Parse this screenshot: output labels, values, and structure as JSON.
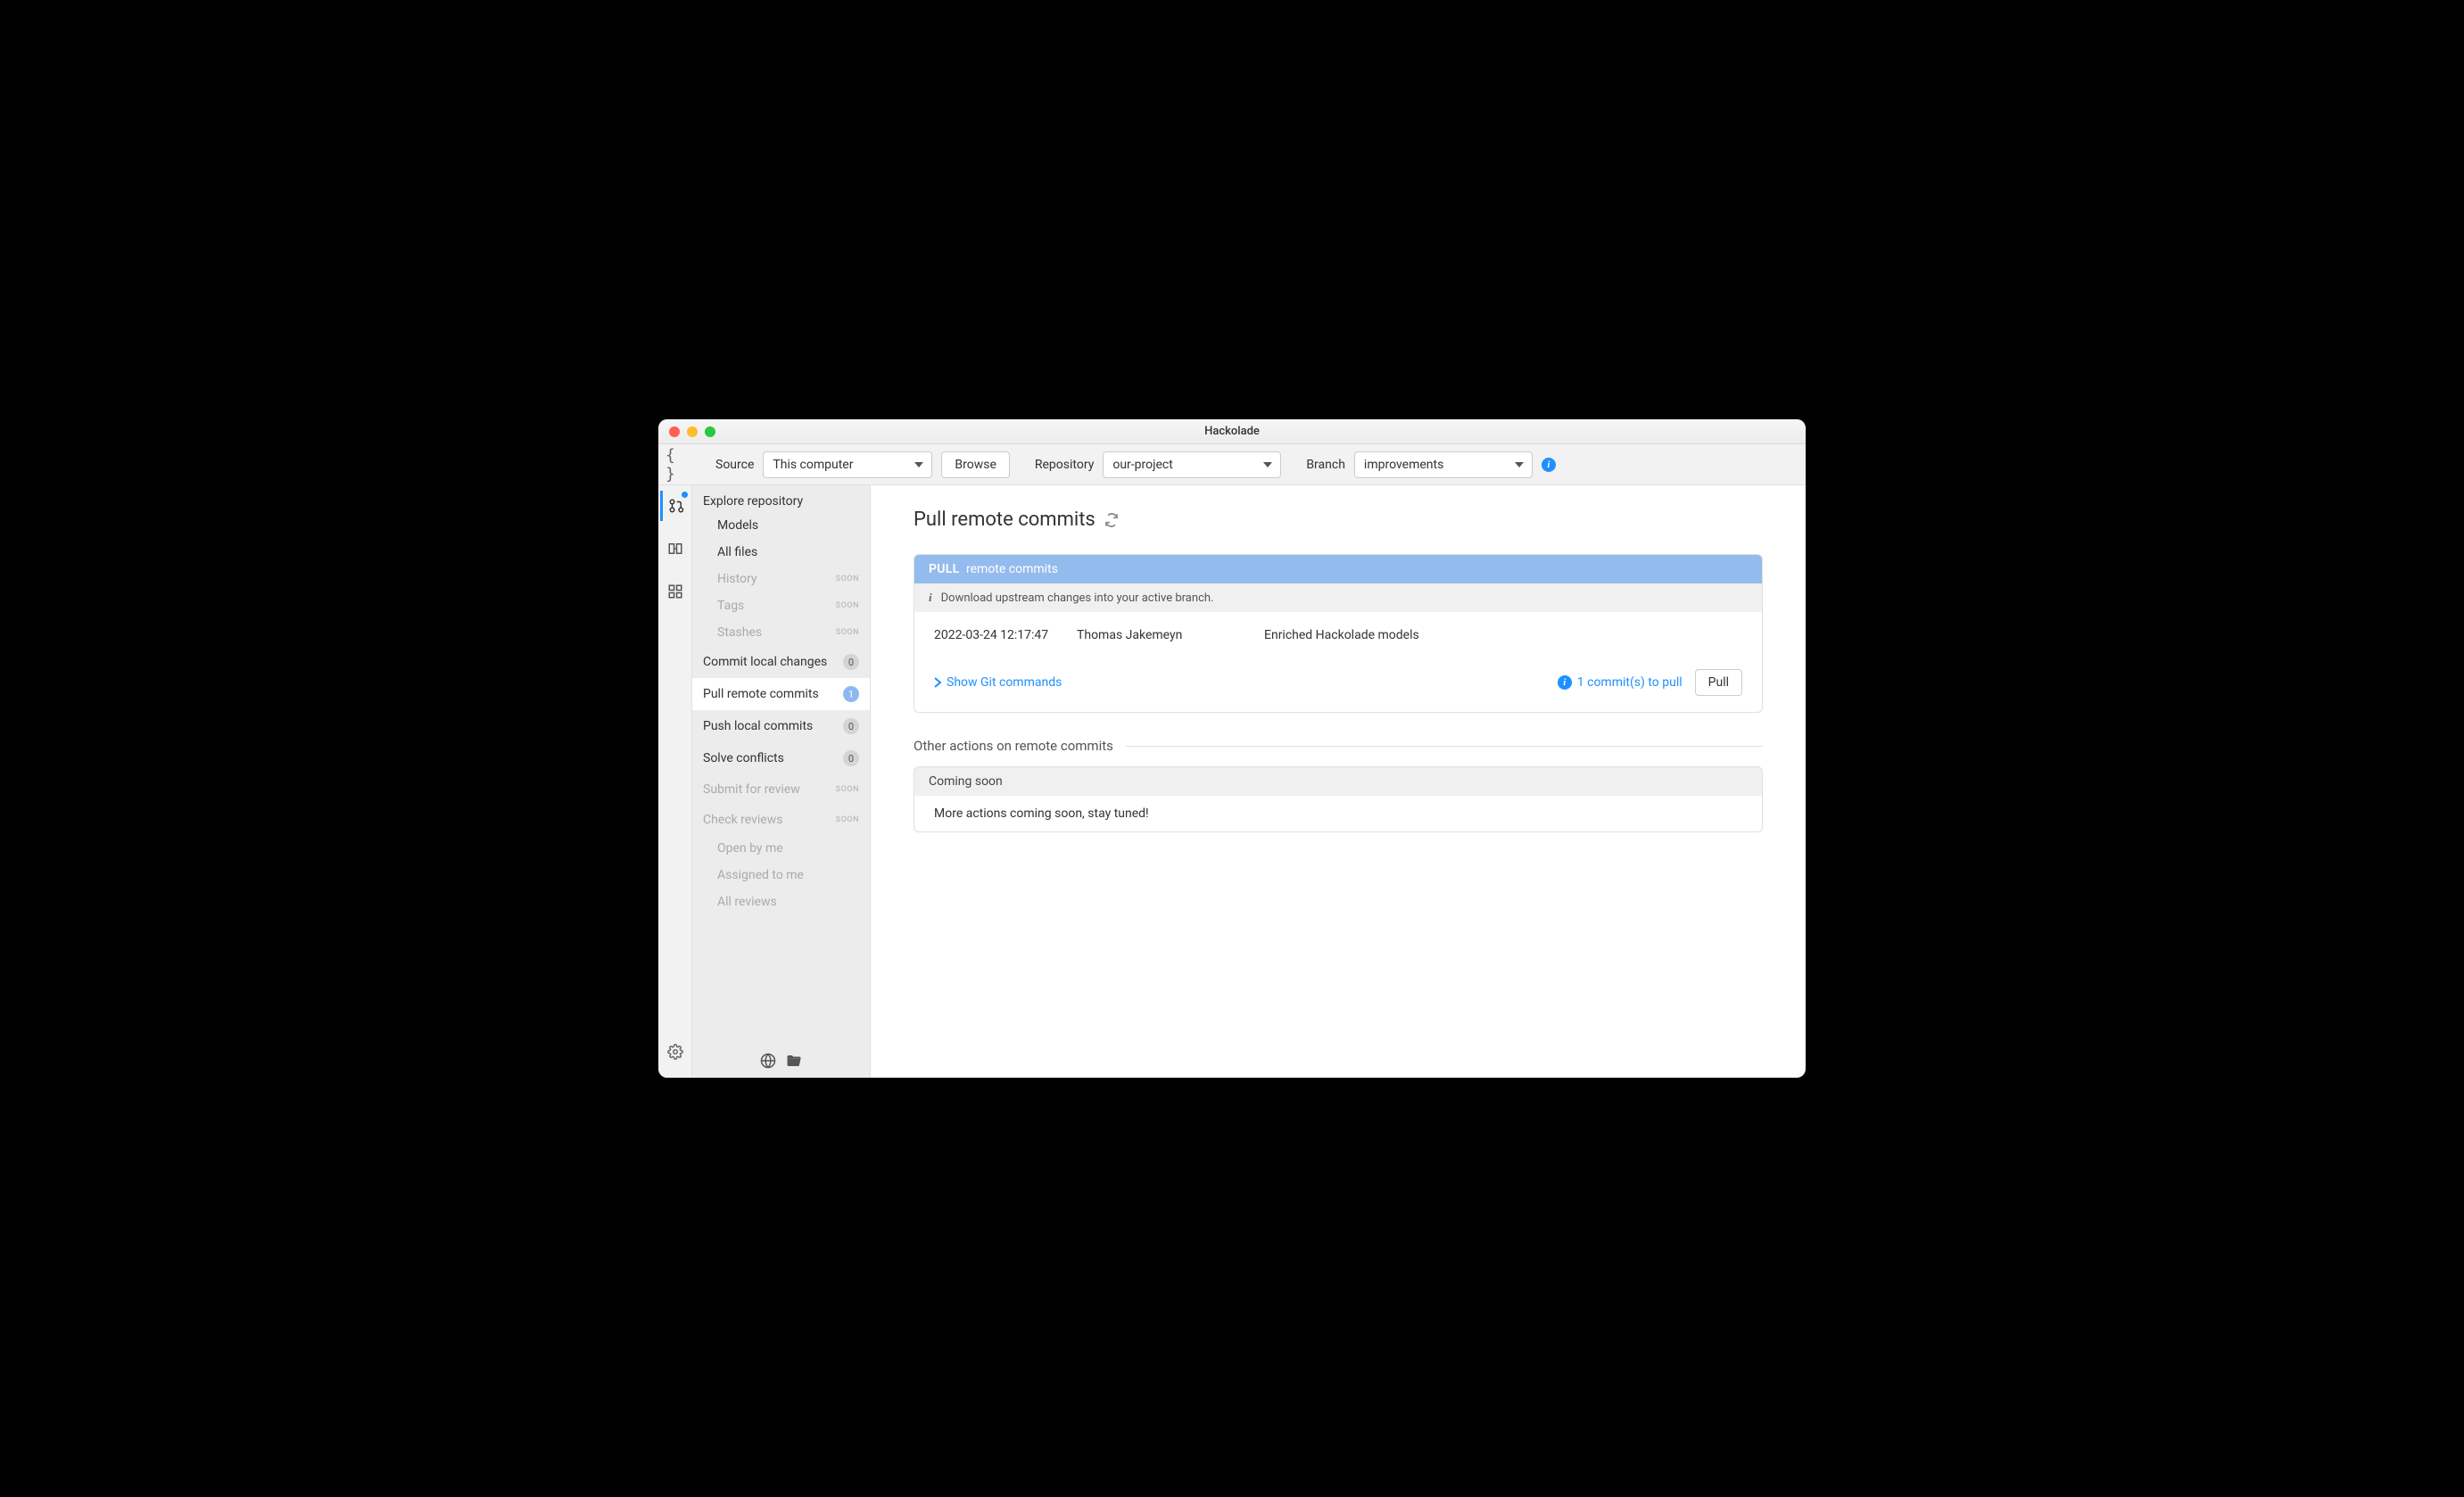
{
  "window": {
    "title": "Hackolade"
  },
  "toolbar": {
    "source_label": "Source",
    "source_value": "This computer",
    "browse_label": "Browse",
    "repo_label": "Repository",
    "repo_value": "our-project",
    "branch_label": "Branch",
    "branch_value": "improvements"
  },
  "sidebar": {
    "explore": "Explore repository",
    "models": "Models",
    "allfiles": "All files",
    "history": "History",
    "tags": "Tags",
    "stashes": "Stashes",
    "soon": "SOON",
    "commit_local": {
      "label": "Commit local changes",
      "count": "0"
    },
    "pull_remote": {
      "label": "Pull remote commits",
      "count": "1"
    },
    "push_local": {
      "label": "Push local commits",
      "count": "0"
    },
    "solve_conflicts": {
      "label": "Solve conflicts",
      "count": "0"
    },
    "submit_review": "Submit for review",
    "check_reviews": "Check reviews",
    "open_by_me": "Open by me",
    "assigned_to_me": "Assigned to me",
    "all_reviews": "All reviews"
  },
  "main": {
    "title": "Pull remote commits",
    "pull_header_strong": "PULL",
    "pull_header_rest": "remote commits",
    "info_text": "Download upstream changes into your active branch.",
    "commit": {
      "date": "2022-03-24 12:17:47",
      "author": "Thomas Jakemeyn",
      "message": "Enriched Hackolade models"
    },
    "show_git": "Show Git commands",
    "commits_to_pull": "1 commit(s) to pull",
    "pull_button": "Pull",
    "other_actions_title": "Other actions on remote commits",
    "coming_soon_header": "Coming soon",
    "coming_soon_body": "More actions coming soon, stay tuned!"
  }
}
